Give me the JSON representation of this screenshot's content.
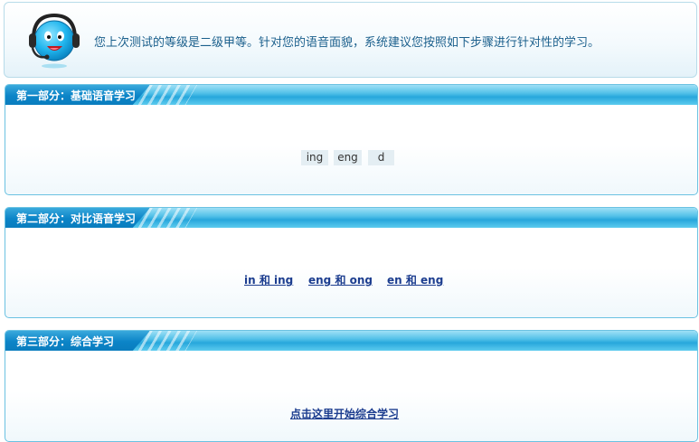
{
  "notice": {
    "avatar_icon": "headset-mascot-icon",
    "text": "您上次测试的等级是二级甲等。针对您的语音面貌，系统建议您按照如下步骤进行针对性的学习。"
  },
  "sections": [
    {
      "title": "第一部分：基础语音学习",
      "items": [
        "ing",
        "eng",
        "d"
      ]
    },
    {
      "title": "第二部分：对比语音学习",
      "links": [
        "in 和 ing",
        "eng 和 ong",
        "en 和 eng"
      ]
    },
    {
      "title": "第三部分：综合学习",
      "link": "点击这里开始综合学习"
    }
  ],
  "colors": {
    "header_accent": "#0b84c7",
    "header_light": "#5ccbee",
    "notice_text": "#1a5f8c",
    "link": "#1c3d8f"
  }
}
